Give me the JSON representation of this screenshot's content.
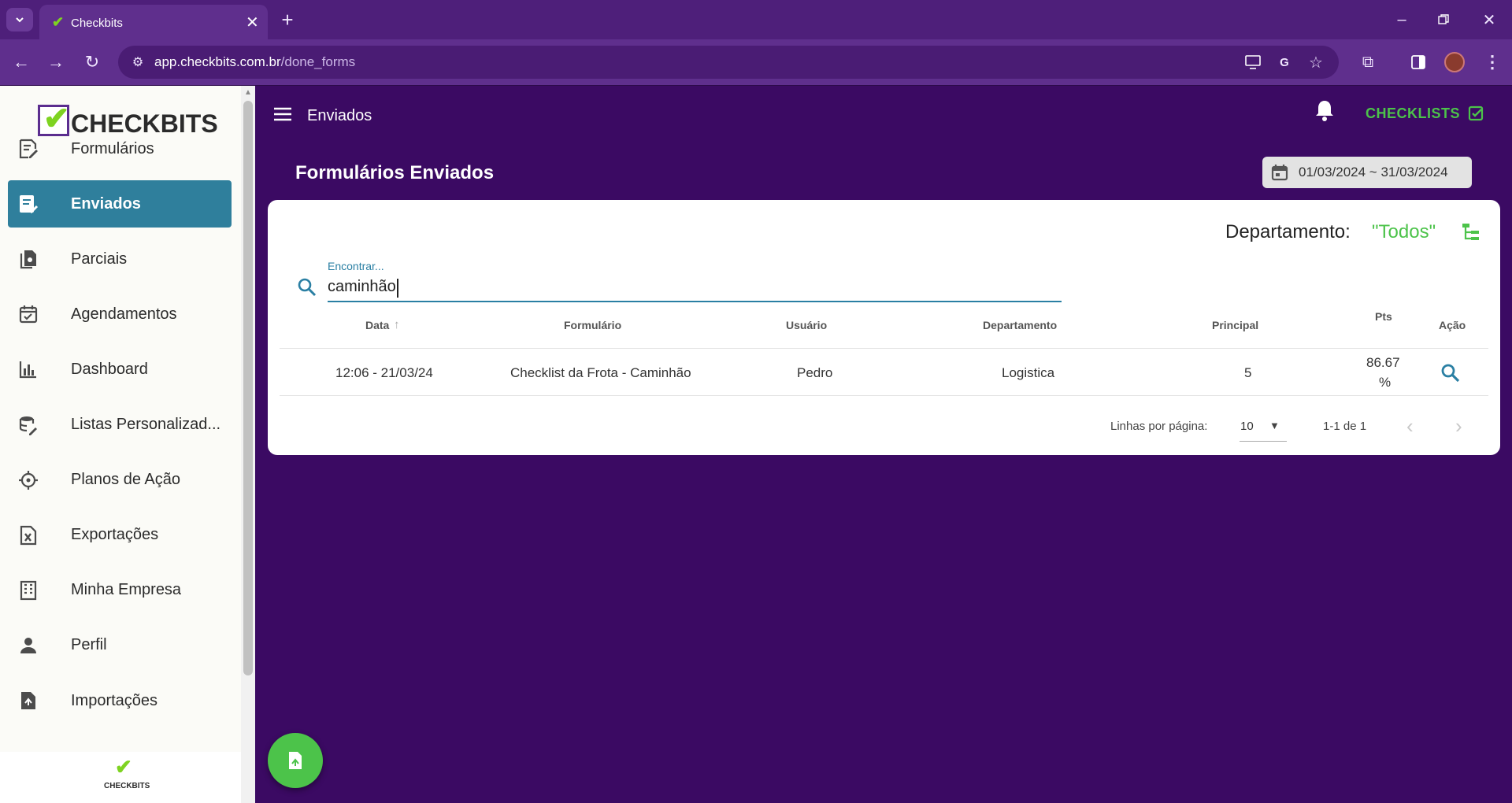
{
  "browser": {
    "tab_title": "Checkbits",
    "url_host": "app.checkbits.com.br",
    "url_path": "/done_forms"
  },
  "header": {
    "title": "Enviados",
    "checklists_label": "CHECKLISTS"
  },
  "sidebar": {
    "logo_text": "CHECKBITS",
    "items": [
      {
        "label": "Formulários",
        "icon": "form-edit-icon"
      },
      {
        "label": "Enviados",
        "icon": "form-sent-icon",
        "active": true
      },
      {
        "label": "Parciais",
        "icon": "partial-docs-icon"
      },
      {
        "label": "Agendamentos",
        "icon": "calendar-check-icon"
      },
      {
        "label": "Dashboard",
        "icon": "bar-chart-icon"
      },
      {
        "label": "Listas Personalizad...",
        "icon": "database-edit-icon"
      },
      {
        "label": "Planos de Ação",
        "icon": "crosshair-icon"
      },
      {
        "label": "Exportações",
        "icon": "excel-file-icon"
      },
      {
        "label": "Minha Empresa",
        "icon": "building-icon"
      },
      {
        "label": "Perfil",
        "icon": "person-icon"
      },
      {
        "label": "Importações",
        "icon": "file-upload-icon"
      }
    ],
    "footer_logo_text": "CHECKBITS"
  },
  "page": {
    "title": "Formulários Enviados",
    "date_range": "01/03/2024 ~ 31/03/2024",
    "department_label": "Departamento:",
    "department_value": "\"Todos\"",
    "search_label": "Encontrar...",
    "search_value": "caminhão"
  },
  "table": {
    "headers": [
      "Data",
      "Formulário",
      "Usuário",
      "Departamento",
      "Principal",
      "Pts",
      "Ação"
    ],
    "rows": [
      {
        "data": "12:06 - 21/03/24",
        "formulario": "Checklist da Frota - Caminhão",
        "usuario": "Pedro",
        "departamento": "Logistica",
        "principal": "5",
        "pts": "86.67",
        "pts_unit": "%"
      }
    ]
  },
  "pagination": {
    "rows_per_page_label": "Linhas por página:",
    "rows_per_page": "10",
    "range": "1-1 de 1"
  },
  "colors": {
    "main_bg": "#3b0a63",
    "active_nav": "#2f7f9c",
    "accent_green": "#4cc34a",
    "search_accent": "#2a7fa3"
  }
}
